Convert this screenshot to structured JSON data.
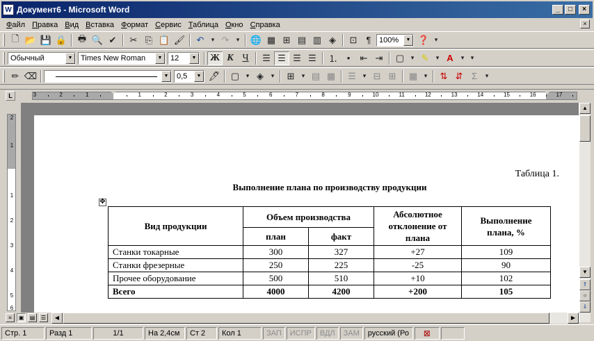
{
  "window": {
    "title": "Документ6 - Microsoft Word",
    "btn_min": "_",
    "btn_max": "□",
    "btn_close": "×",
    "doc_close": "×"
  },
  "menu": [
    "Файл",
    "Правка",
    "Вид",
    "Вставка",
    "Формат",
    "Сервис",
    "Таблица",
    "Окно",
    "Справка"
  ],
  "toolbar_standard": {
    "zoom": "100%"
  },
  "toolbar_format": {
    "style": "Обычный",
    "font": "Times New Roman",
    "size": "12",
    "bold": "Ж",
    "italic": "К",
    "underline": "Ч"
  },
  "toolbar_tables": {
    "line_weight": "0,5"
  },
  "ruler": {
    "ticks": [
      "3",
      "2",
      "1",
      "1",
      "2",
      "3",
      "4",
      "5",
      "6",
      "7",
      "8",
      "9",
      "10",
      "11",
      "12",
      "13",
      "14",
      "15",
      "16",
      "17"
    ],
    "vticks": [
      "2",
      "1",
      "1",
      "2",
      "3",
      "4",
      "5",
      "6"
    ]
  },
  "document": {
    "caption": "Таблица 1.",
    "heading": "Выполнение плана по производству продукции",
    "table": {
      "col_product": "Вид продукции",
      "col_volume": "Объем производства",
      "col_plan": "план",
      "col_fact": "факт",
      "col_deviation": "Абсолютное отклонение от плана",
      "col_fulfillment": "Выполнение плана, %",
      "rows": [
        {
          "name": "Станки токарные",
          "plan": "300",
          "fact": "327",
          "dev": "+27",
          "pct": "109"
        },
        {
          "name": "Станки фрезерные",
          "plan": "250",
          "fact": "225",
          "dev": "-25",
          "pct": "90"
        },
        {
          "name": "Прочее оборудование",
          "plan": "500",
          "fact": "510",
          "dev": "+10",
          "pct": "102"
        }
      ],
      "total": {
        "name": "Всего",
        "plan": "4000",
        "fact": "4200",
        "dev": "+200",
        "pct": "105"
      }
    }
  },
  "statusbar": {
    "page": "Стр. 1",
    "section": "Разд 1",
    "pages": "1/1",
    "at": "На 2,4см",
    "line": "Ст 2",
    "col": "Кол 1",
    "rec": "ЗАП",
    "trk": "ИСПР",
    "ext": "ВДЛ",
    "ovr": "ЗАМ",
    "lang": "русский (Ро"
  }
}
